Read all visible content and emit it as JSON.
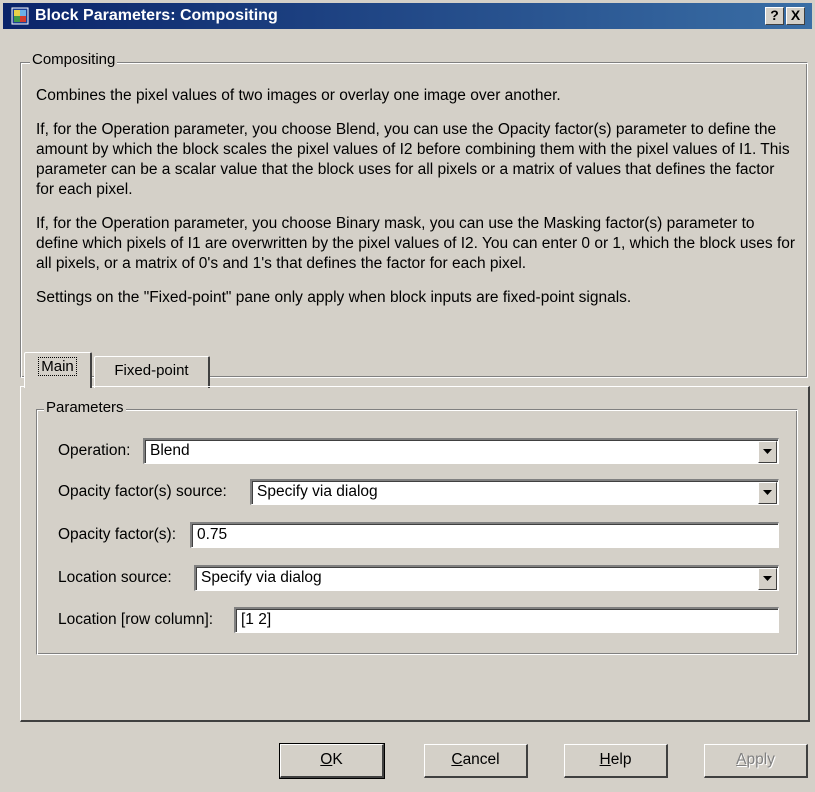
{
  "window": {
    "title": "Block Parameters: Compositing",
    "help_glyph": "?",
    "close_glyph": "X"
  },
  "description": {
    "group_label": "Compositing",
    "paragraphs": [
      "Combines the pixel values of two images or overlay one image over another.",
      "If, for the Operation parameter, you choose Blend, you can use the Opacity factor(s) parameter to define the amount by which the block scales the pixel values of I2 before combining them with the pixel values of I1. This parameter can be a scalar value that the block uses for all pixels or a matrix of values that defines the factor for each pixel.",
      "If, for the Operation parameter, you choose Binary mask, you can use the Masking factor(s) parameter to define which pixels of I1 are overwritten by the pixel values of I2. You can enter 0 or 1, which the block uses for all pixels, or a matrix of 0's and 1's that defines the factor for each pixel.",
      "Settings on the \"Fixed-point\" pane only apply when block inputs are fixed-point signals."
    ]
  },
  "tabs": [
    {
      "label": "Main",
      "active": true
    },
    {
      "label": "Fixed-point",
      "active": false
    }
  ],
  "parameters": {
    "group_label": "Parameters",
    "operation": {
      "label": "Operation:",
      "value": "Blend"
    },
    "opacity_source": {
      "label": "Opacity factor(s) source:",
      "value": "Specify via dialog"
    },
    "opacity_factor": {
      "label": "Opacity factor(s):",
      "value": "0.75"
    },
    "location_source": {
      "label": "Location source:",
      "value": "Specify via dialog"
    },
    "location": {
      "label": "Location [row column]:",
      "value": "[1 2]"
    }
  },
  "buttons": {
    "ok": {
      "label": "OK",
      "mnemonic": "O",
      "rest": "K"
    },
    "cancel": {
      "label": "Cancel",
      "mnemonic": "C",
      "rest": "ancel"
    },
    "help": {
      "label": "Help",
      "mnemonic": "H",
      "rest": "elp"
    },
    "apply": {
      "label": "Apply",
      "mnemonic": "A",
      "rest": "pply",
      "disabled": true
    }
  },
  "icons": [
    "simulink-block-icon",
    "chevron-down-icon"
  ]
}
